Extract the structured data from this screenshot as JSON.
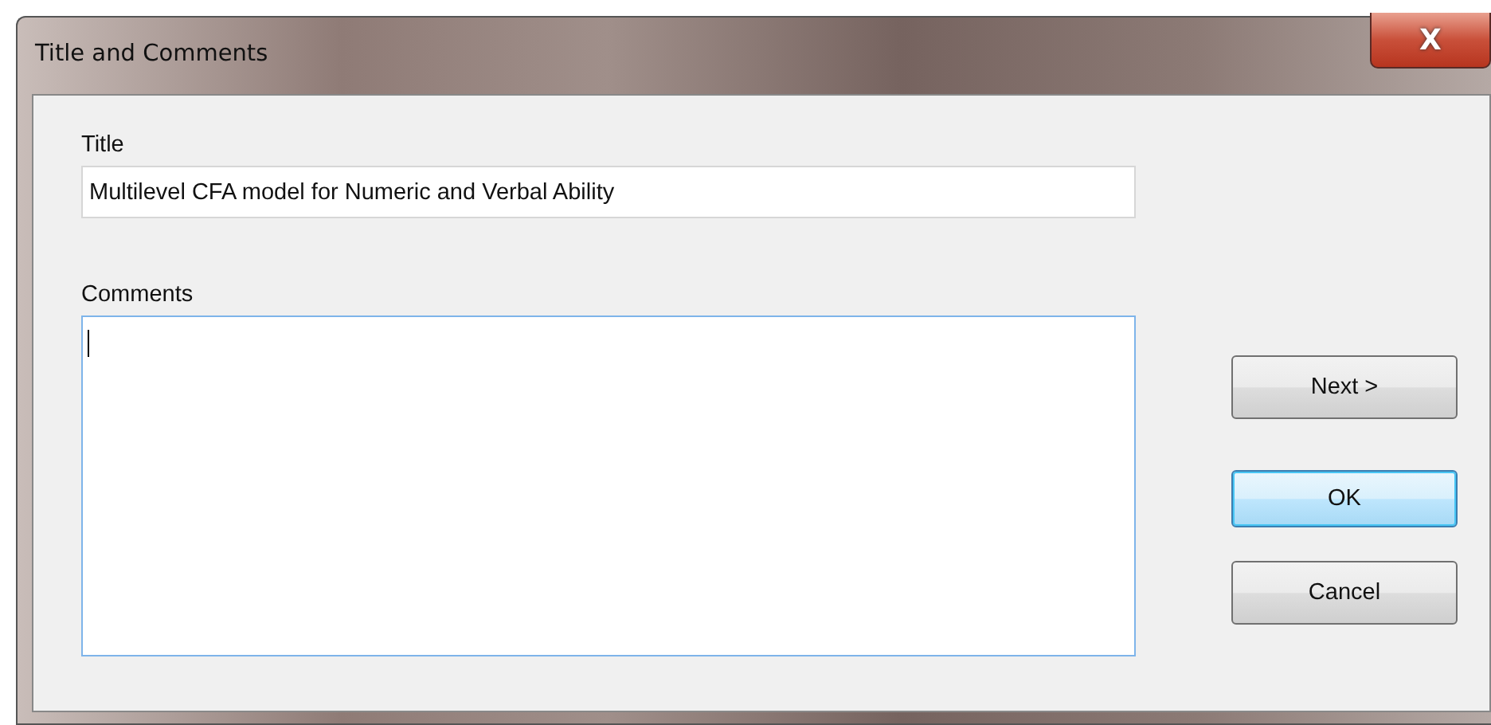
{
  "window": {
    "title": "Title and Comments",
    "close": "X"
  },
  "title_field": {
    "label": "Title",
    "value": "Multilevel CFA model for Numeric and Verbal Ability",
    "focused": false
  },
  "comments_field": {
    "label": "Comments",
    "focused": true
  },
  "buttons": [
    {
      "label": "Next >",
      "default": false
    },
    {
      "label": "OK",
      "default": true
    },
    {
      "label": "Cancel",
      "default": false
    }
  ]
}
